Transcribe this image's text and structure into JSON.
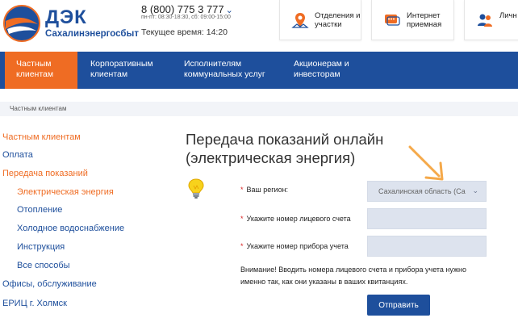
{
  "header": {
    "logo_name": "ДЭК",
    "logo_sub": "Сахалинэнергосбыт",
    "phone": "8 (800) 775 3 777",
    "hours": "пн-пт: 08:30-18:30, сб: 09:00-15:00",
    "time": "Текущее время: 14:20",
    "buttons": [
      {
        "label": "Отделения и участки",
        "icon": "map-pin-icon"
      },
      {
        "label": "Интернет приемная",
        "icon": "chat-icon"
      },
      {
        "label": "Личн",
        "icon": "users-icon"
      }
    ]
  },
  "nav": {
    "items": [
      {
        "label": "Частным клиентам",
        "active": true
      },
      {
        "label": "Корпоративным клиентам"
      },
      {
        "label": "Исполнителям коммунальных услуг"
      },
      {
        "label": "Акционерам и инвесторам"
      }
    ]
  },
  "breadcrumb": "Частным клиентам",
  "sidebar": {
    "items": [
      {
        "label": "Частным клиентам"
      },
      {
        "label": "Оплата"
      },
      {
        "label": "Передача показаний"
      },
      {
        "label": "Электрическая энергия"
      },
      {
        "label": "Отопление"
      },
      {
        "label": "Холодное водоснабжение"
      },
      {
        "label": "Инструкция"
      },
      {
        "label": "Все способы"
      },
      {
        "label": "Офисы, обслуживание"
      },
      {
        "label": "ЕРИЦ г. Холмск"
      }
    ]
  },
  "main": {
    "title_line1": "Передача показаний онлайн",
    "title_line2": "(электрическая энергия)",
    "required_mark": "*",
    "region_label": "Ваш регион:",
    "region_value": "Сахалинская область (Са",
    "account_label": "Укажите номер лицевого счета",
    "account_value": "",
    "meter_label": "Укажите номер прибора учета",
    "meter_value": "",
    "note": "Внимание! Вводить номера лицевого счета и прибора учета нужно именно так, как они указаны в ваших квитанциях.",
    "submit_label": "Отправить"
  },
  "colors": {
    "brand_blue": "#1e4f9c",
    "accent_orange": "#ef6c23",
    "input_bg": "#dde3ee"
  }
}
